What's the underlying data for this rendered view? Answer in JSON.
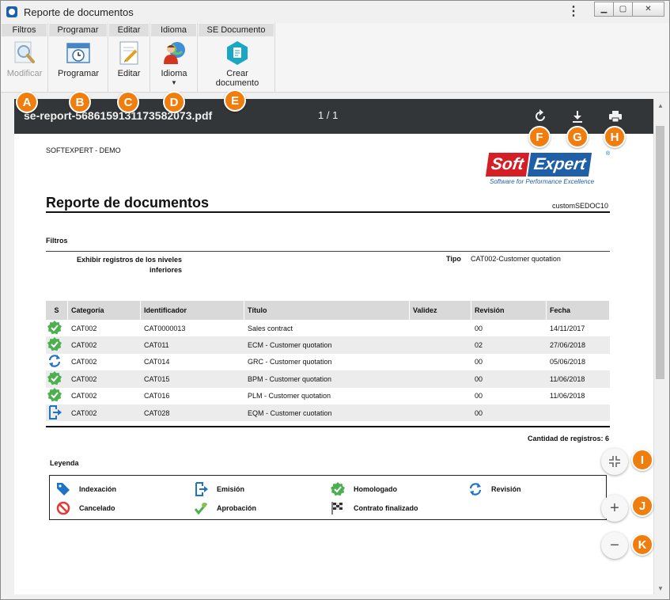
{
  "window": {
    "title": "Reporte de documentos"
  },
  "ribbon": {
    "groups": [
      {
        "title": "Filtros",
        "button": "Modificar"
      },
      {
        "title": "Programar",
        "button": "Programar"
      },
      {
        "title": "Editar",
        "button": "Editar"
      },
      {
        "title": "Idioma",
        "button": "Idioma"
      },
      {
        "title": "SE Documento",
        "button": "Crear documento"
      }
    ]
  },
  "viewer": {
    "filename": "se-report-5686159131173582073.pdf",
    "pages": "1 / 1"
  },
  "document": {
    "company": "SOFTEXPERT - DEMO",
    "logo": {
      "soft": "Soft",
      "expert": "Expert",
      "tagline": "Software for Performance Excellence",
      "reg": "®"
    },
    "title": "Reporte de documentos",
    "code": "customSEDOC10",
    "filters_label": "Filtros",
    "filter_name": "Exhibir registros de los niveles inferiores",
    "filter_tipo_label": "Tipo",
    "filter_tipo_value": "CAT002-Customer quotation",
    "table": {
      "headers": [
        "S",
        "Categoría",
        "Identificador",
        "Título",
        "Validez",
        "Revisión",
        "Fecha"
      ],
      "rows": [
        {
          "status": "homologado",
          "categoria": "CAT002",
          "id": "CAT0000013",
          "titulo": "Sales contract",
          "validez": "",
          "revision": "00",
          "fecha": "14/11/2017"
        },
        {
          "status": "homologado",
          "categoria": "CAT002",
          "id": "CAT011",
          "titulo": "ECM - Customer quotation",
          "validez": "",
          "revision": "02",
          "fecha": "27/06/2018"
        },
        {
          "status": "revision",
          "categoria": "CAT002",
          "id": "CAT014",
          "titulo": "GRC - Customer quotation",
          "validez": "",
          "revision": "00",
          "fecha": "05/06/2018"
        },
        {
          "status": "homologado",
          "categoria": "CAT002",
          "id": "CAT015",
          "titulo": "BPM - Customer quotation",
          "validez": "",
          "revision": "00",
          "fecha": "11/06/2018"
        },
        {
          "status": "homologado",
          "categoria": "CAT002",
          "id": "CAT016",
          "titulo": "PLM - Customer quotation",
          "validez": "",
          "revision": "00",
          "fecha": "11/06/2018"
        },
        {
          "status": "emision",
          "categoria": "CAT002",
          "id": "CAT028",
          "titulo": "EQM - Customer cuotation",
          "validez": "",
          "revision": "00",
          "fecha": ""
        }
      ]
    },
    "count": "Cantidad de registros: 6",
    "legend_title": "Leyenda",
    "legend": [
      {
        "icon": "indexacion",
        "label": "Indexación"
      },
      {
        "icon": "emision",
        "label": "Emisión"
      },
      {
        "icon": "homologado",
        "label": "Homologado"
      },
      {
        "icon": "revision",
        "label": "Revisión"
      },
      {
        "icon": "cancelado",
        "label": "Cancelado"
      },
      {
        "icon": "aprobacion",
        "label": "Aprobación"
      },
      {
        "icon": "contrato",
        "label": "Contrato finalizado"
      }
    ]
  },
  "callouts": [
    "A",
    "B",
    "C",
    "D",
    "E",
    "F",
    "G",
    "H",
    "I",
    "J",
    "K"
  ],
  "colors": {
    "accent": "#ef7e0e",
    "toolbar": "#323639",
    "approved_green": "#4caf50",
    "revision_blue": "#1f72c4"
  }
}
